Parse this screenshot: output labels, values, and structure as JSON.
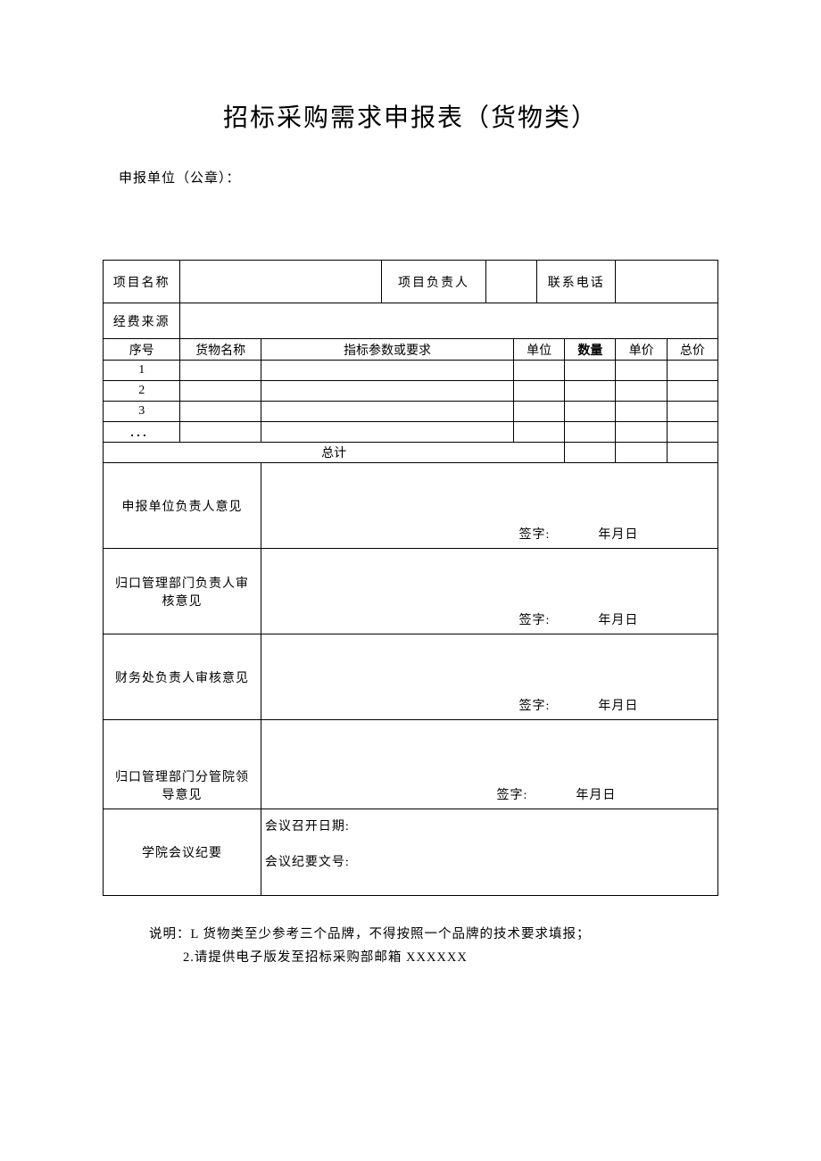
{
  "title": "招标采购需求申报表（货物类）",
  "subtitle": "申报单位（公章）：",
  "header_row": {
    "project_name_label": "项目名称",
    "project_name_value": "",
    "project_leader_label": "项目负责人",
    "project_leader_value": "",
    "contact_phone_label": "联系电话",
    "contact_phone_value": ""
  },
  "funding_row": {
    "label": "经费来源",
    "value": ""
  },
  "items_header": {
    "seq": "序号",
    "name": "货物名称",
    "spec": "指标参数或要求",
    "unit": "单位",
    "qty": "数量",
    "price": "单价",
    "total": "总价"
  },
  "items": [
    {
      "seq": "1",
      "name": "",
      "spec": "",
      "unit": "",
      "qty": "",
      "price": "",
      "total": ""
    },
    {
      "seq": "2",
      "name": "",
      "spec": "",
      "unit": "",
      "qty": "",
      "price": "",
      "total": ""
    },
    {
      "seq": "3",
      "name": "",
      "spec": "",
      "unit": "",
      "qty": "",
      "price": "",
      "total": ""
    },
    {
      "seq": "．．．",
      "name": "",
      "spec": "",
      "unit": "",
      "qty": "",
      "price": "",
      "total": ""
    }
  ],
  "total_label": "总计",
  "approvals": {
    "unit_leader": "申报单位负责人意见",
    "mgmt_leader": "归口管理部门负责人审核意见",
    "finance_leader": "财务处负责人审核意见",
    "division_leader": "归口管理部门分管院领导意见",
    "meeting_label": "学院会议纪要",
    "sign_label": "签字:",
    "date_label": "年月日",
    "meeting_date_label": "会议召开日期:",
    "meeting_no_label": "会议纪要文号:"
  },
  "notes": {
    "line1": "说明：L 货物类至少参考三个品牌，不得按照一个品牌的技术要求填报；",
    "line2": "2.请提供电子版发至招标采购部邮箱 XXXXXX"
  }
}
